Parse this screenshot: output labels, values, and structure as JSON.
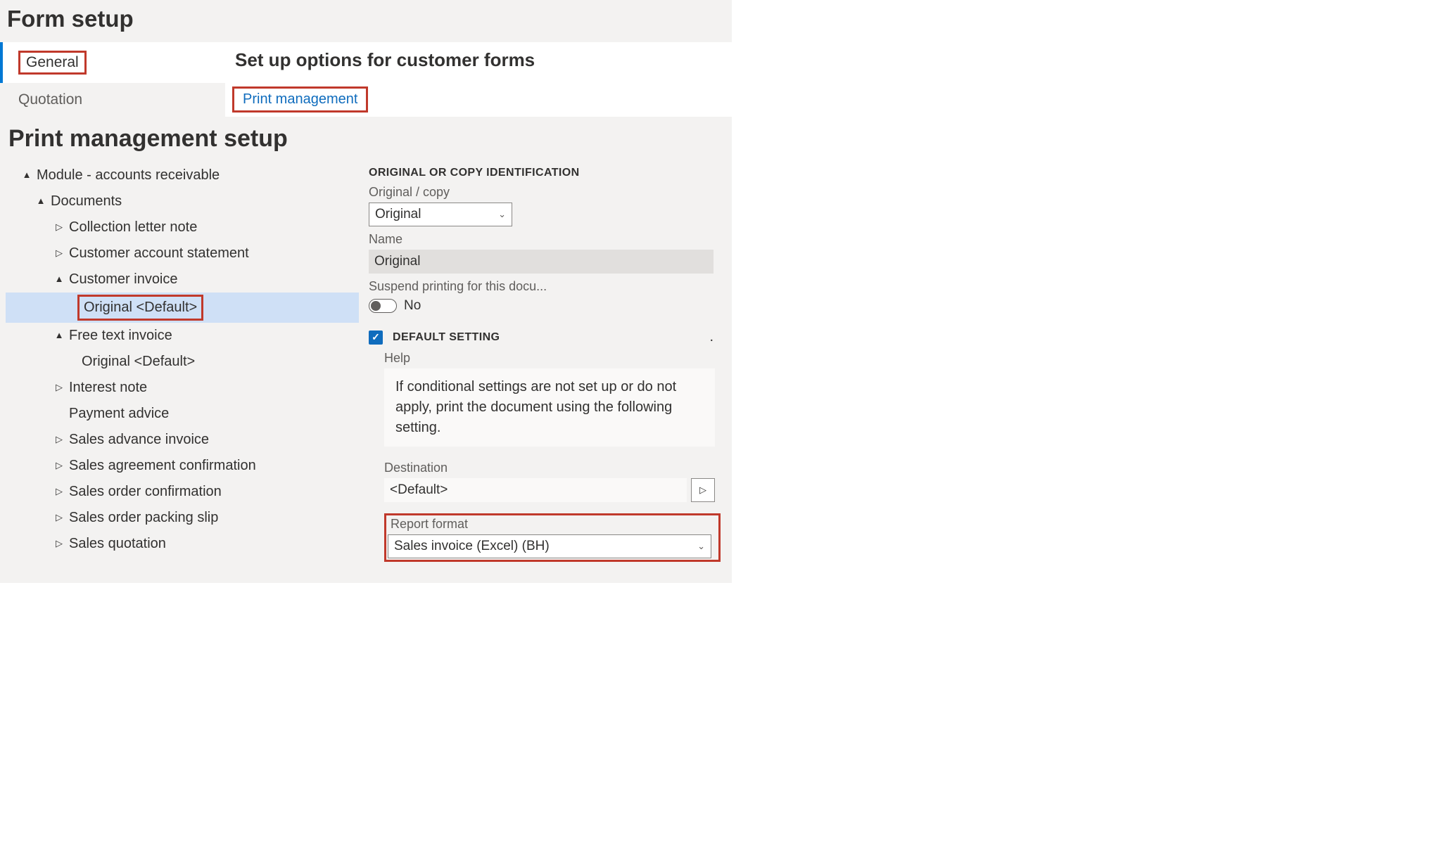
{
  "page_title": "Form setup",
  "side_tabs": {
    "general": "General",
    "quotation": "Quotation"
  },
  "content": {
    "title": "Set up options for customer forms",
    "print_mgmt_link": "Print management"
  },
  "pm_setup": {
    "title": "Print management setup",
    "tree": {
      "root": "Module - accounts receivable",
      "docs_label": "Documents",
      "items": {
        "collection": "Collection letter note",
        "account_stmt": "Customer account statement",
        "cust_invoice": "Customer invoice",
        "cust_invoice_default": "Original <Default>",
        "free_text": "Free text invoice",
        "free_text_default": "Original <Default>",
        "interest": "Interest note",
        "payment_advice": "Payment advice",
        "sales_advance": "Sales advance invoice",
        "sales_agreement": "Sales agreement confirmation",
        "sales_order_conf": "Sales order confirmation",
        "sales_packing": "Sales order packing slip",
        "sales_quote": "Sales quotation"
      }
    },
    "props": {
      "section_id": "ORIGINAL OR COPY IDENTIFICATION",
      "orig_copy_label": "Original / copy",
      "orig_copy_value": "Original",
      "name_label": "Name",
      "name_value": "Original",
      "suspend_label": "Suspend printing for this docu...",
      "suspend_value": "No",
      "default_setting_label": "DEFAULT SETTING",
      "default_dot": ".",
      "help_label": "Help",
      "help_text": "If conditional settings are not set up or do not apply, print the document using the following setting.",
      "dest_label": "Destination",
      "dest_value": "<Default>",
      "report_label": "Report format",
      "report_value": "Sales invoice (Excel) (BH)"
    }
  }
}
